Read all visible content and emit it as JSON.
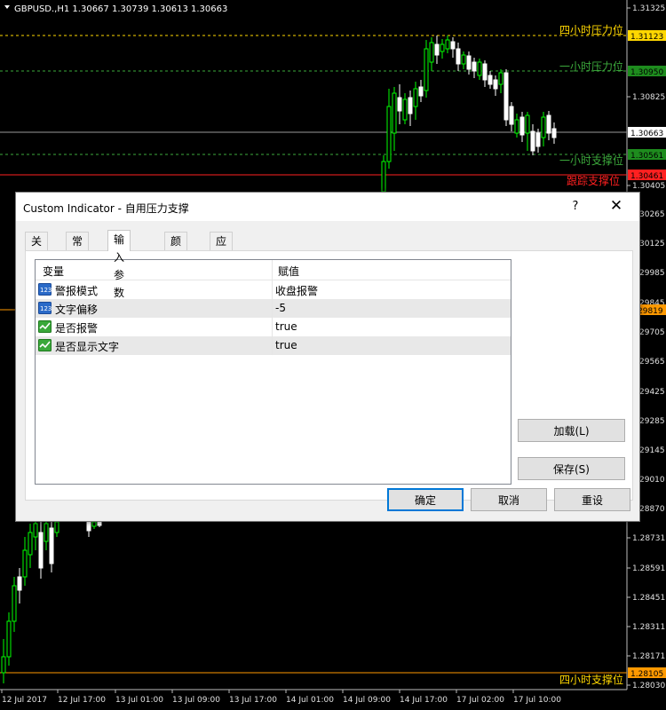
{
  "chart": {
    "symbol_title": "GBPUSD.,H1  1.30667 1.30739 1.30613 1.30663",
    "y_ticks": [
      "1.31325",
      "1.30825",
      "1.30405",
      "30265",
      "30125",
      "29985",
      "29845",
      "29705",
      "29565",
      "29425",
      "29285",
      "29145",
      "29010",
      "28870",
      "1.28731",
      "1.28591",
      "1.28451",
      "1.28311",
      "1.28171",
      "1.28030"
    ],
    "price_tags": {
      "resistance_4h": "1.31123",
      "resistance_1h": "1.30950",
      "current": "1.30663",
      "support_1h": "1.30561",
      "red_line": "1.30461",
      "orange_mid": "29819",
      "support_4h": "1.28105"
    },
    "levels": {
      "resistance_4h": "四小时压力位",
      "resistance_1h": "一小时压力位",
      "support_1h": "一小时支撑位",
      "red_label": "跟踪支撑位",
      "support_4h": "四小时支撑位"
    },
    "x_labels": [
      "12 Jul 2017",
      "12 Jul 17:00",
      "13 Jul 01:00",
      "13 Jul 09:00",
      "13 Jul 17:00",
      "14 Jul 01:00",
      "14 Jul 09:00",
      "14 Jul 17:00",
      "17 Jul 02:00",
      "17 Jul 10:00"
    ],
    "colors": {
      "bull": "#00ff00",
      "bear": "#ffffff",
      "resistance": "#ffd700",
      "support": "#3caa3c",
      "red": "#ff2020",
      "orange": "#ff9900"
    }
  },
  "dialog": {
    "title": "Custom Indicator - 自用压力支撑",
    "help": "?",
    "close": "✕",
    "tabs": [
      "关于",
      "常用",
      "输入参数",
      "颜色",
      "应用范围"
    ],
    "active_tab": "输入参数",
    "grid": {
      "col_variable": "变量",
      "col_value": "赋值",
      "rows": [
        {
          "icon": "number-icon",
          "name": "警报模式",
          "value": "收盘报警"
        },
        {
          "icon": "number-icon",
          "name": "文字偏移",
          "value": "-5"
        },
        {
          "icon": "bool-icon",
          "name": "是否报警",
          "value": "true"
        },
        {
          "icon": "bool-icon",
          "name": "是否显示文字",
          "value": "true"
        }
      ]
    },
    "buttons": {
      "load": "加载(L)",
      "save": "保存(S)",
      "ok": "确定",
      "cancel": "取消",
      "reset": "重设"
    }
  }
}
